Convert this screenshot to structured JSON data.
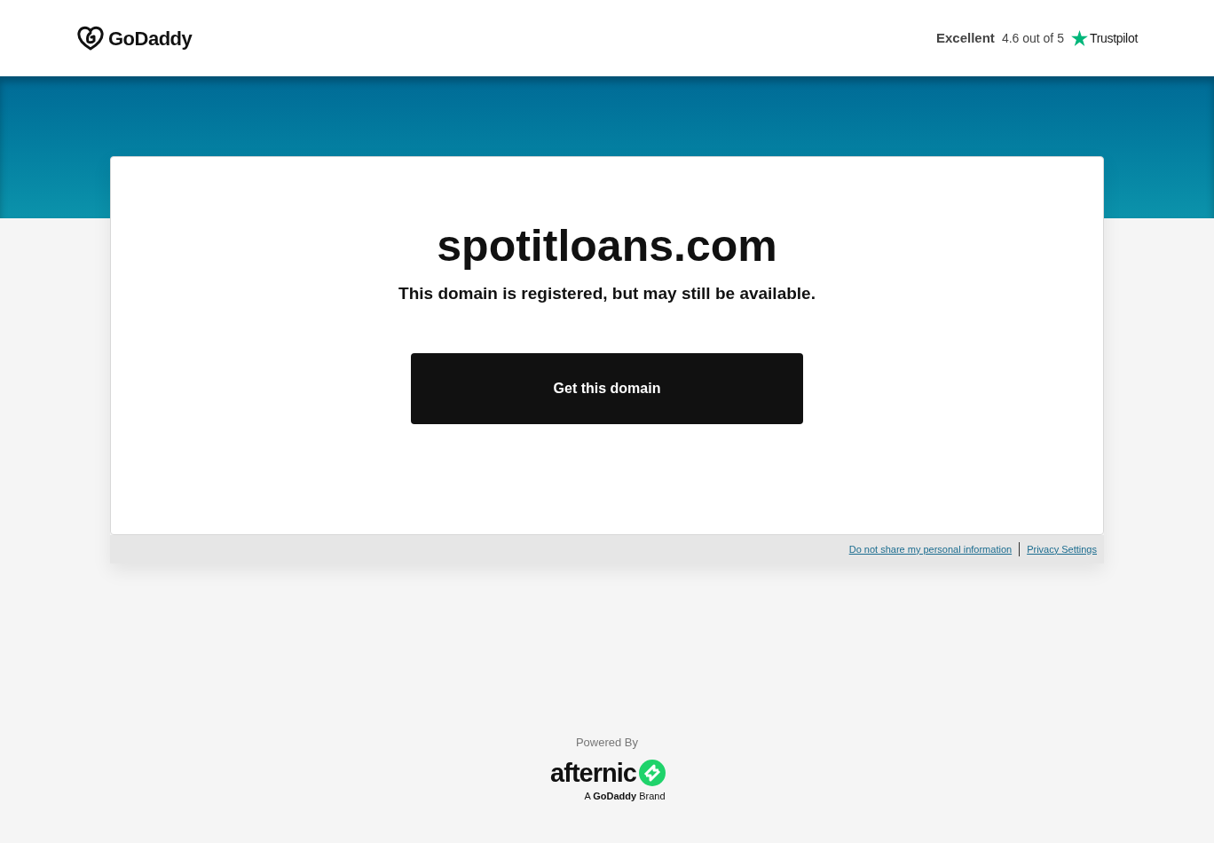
{
  "header": {
    "logo": "GoDaddy",
    "rating_label": "Excellent",
    "rating": "4.6 out of 5",
    "reviews_brand": "Trustpilot"
  },
  "card": {
    "domain": "spotitloans.com",
    "message": "This domain is registered, but may still be available.",
    "button": "Get this domain"
  },
  "footer_links": [
    "Do not share my personal information",
    "Privacy Settings"
  ],
  "powered": {
    "label": "Powered By",
    "brand": "afternic",
    "tagline": "A **GoDaddy** Brand"
  }
}
